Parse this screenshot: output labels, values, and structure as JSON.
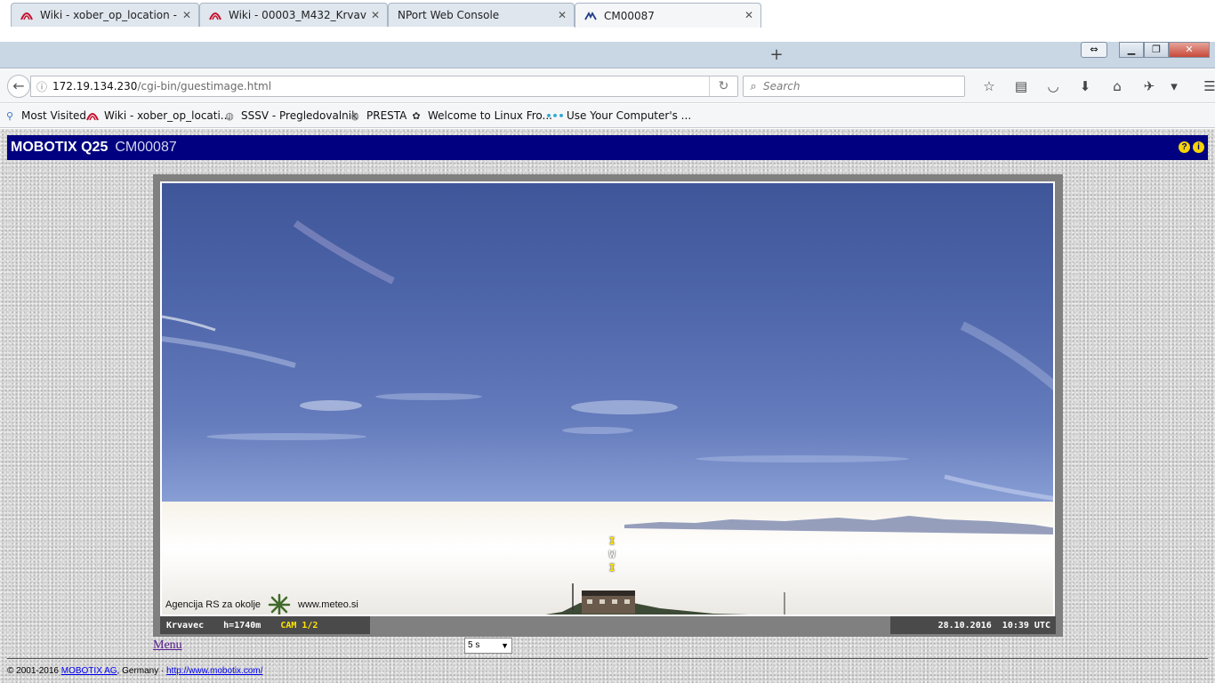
{
  "browser": {
    "tabs": [
      {
        "title": "Wiki - xober_op_location - ...",
        "icon": "wiki-icon",
        "active": false
      },
      {
        "title": "Wiki - 00003_M432_Krvave...",
        "icon": "wiki-icon",
        "active": false
      },
      {
        "title": "NPort Web Console",
        "icon": "",
        "active": false
      },
      {
        "title": "CM00087",
        "icon": "mobotix-icon",
        "active": true
      }
    ],
    "url": {
      "host": "172.19.134.230",
      "path": "/cgi-bin/guestimage.html"
    },
    "search_placeholder": "Search",
    "bookmarks": [
      {
        "label": "Most Visited",
        "icon": "most-visited-icon"
      },
      {
        "label": "Wiki - xober_op_locati...",
        "icon": "wiki-icon"
      },
      {
        "label": "SSSV - Pregledovalnik",
        "icon": "globe-icon"
      },
      {
        "label": "PRESTA",
        "icon": "globe-icon"
      },
      {
        "label": "Welcome to Linux Fro...",
        "icon": "linux-icon"
      },
      {
        "label": "Use Your Computer's ...",
        "icon": "dots-icon"
      }
    ]
  },
  "camera": {
    "model": "MOBOTIX Q25",
    "name": "CM00087",
    "overlay": {
      "agency": "Agencija RS za okolje",
      "website": "www.meteo.si",
      "compass": [
        "I",
        "W",
        "I"
      ]
    },
    "osd_left": {
      "location": "Krvavec",
      "height": "h=1740m",
      "cam": "CAM 1/2"
    },
    "osd_right": "28.10.2016  10:39 UTC",
    "menu_label": "Menu",
    "interval": "5 s"
  },
  "footer": {
    "copyright": "© 2001-2016 ",
    "company": "MOBOTIX AG",
    "country": ", Germany · ",
    "site": "http://www.mobotix.com/"
  },
  "colors": {
    "header_bg": "#000080",
    "osd_yellow": "#ffe400",
    "help_icon": "#f5d400"
  }
}
